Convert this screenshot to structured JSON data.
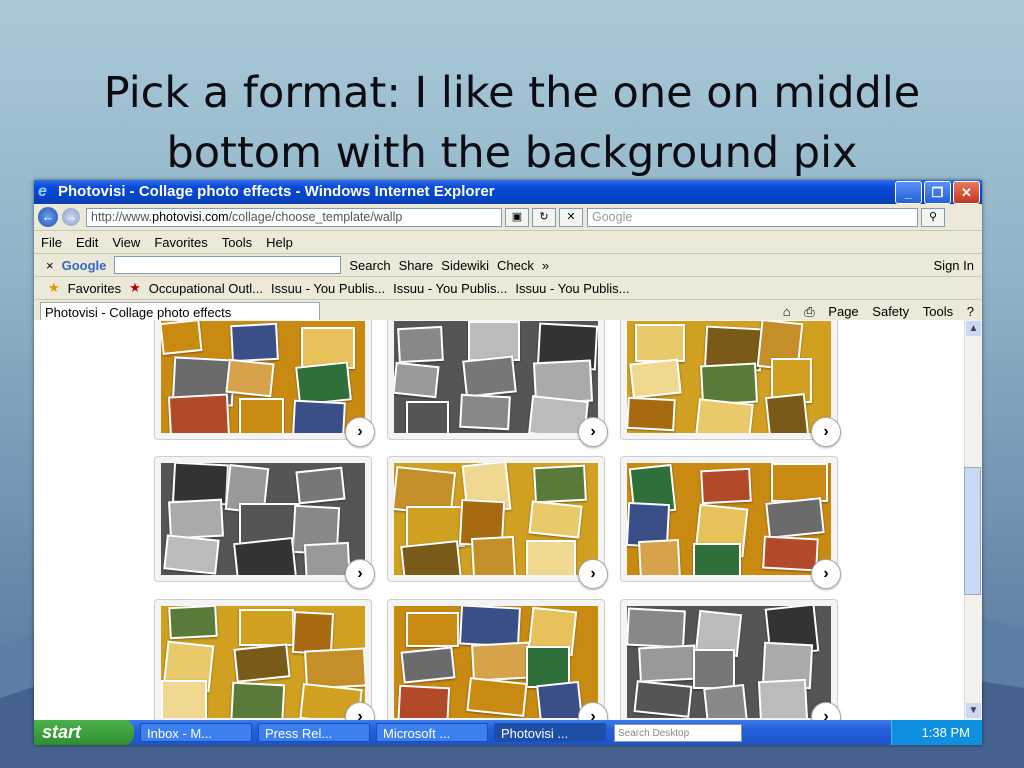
{
  "slide": {
    "title": "Pick a format: I like the one on middle bottom with the background pix"
  },
  "window": {
    "title": "Photovisi - Collage photo effects - Windows Internet Explorer",
    "minimize": "_",
    "maximize": "❐",
    "close": "✕"
  },
  "address": {
    "prefix": "http://www.",
    "domain": "photovisi.com",
    "path": "/collage/choose_template/wallp",
    "search_placeholder": "Google"
  },
  "menu": [
    "File",
    "Edit",
    "View",
    "Favorites",
    "Tools",
    "Help"
  ],
  "google_toolbar": {
    "logo": "Google",
    "search": "Search",
    "share": "Share",
    "sidewiki": "Sidewiki",
    "check": "Check",
    "more": "»",
    "sign_in": "Sign In"
  },
  "favorites_bar": {
    "favorites": "Favorites",
    "items": [
      "Occupational Outl...",
      "Issuu - You Publis...",
      "Issuu - You Publis...",
      "Issuu - You Publis..."
    ]
  },
  "tab": {
    "label": "Photovisi - Collage photo effects"
  },
  "command_bar": {
    "page": "Page",
    "safety": "Safety",
    "tools": "Tools"
  },
  "taskbar": {
    "start": "start",
    "tasks": [
      "Inbox - M...",
      "Press Rel...",
      "Microsoft ...",
      "Photovisi ..."
    ],
    "desktop_search": "Search Desktop",
    "clock": "1:38 PM"
  },
  "icons": {
    "next": "›",
    "back": "←",
    "forward": "→"
  }
}
